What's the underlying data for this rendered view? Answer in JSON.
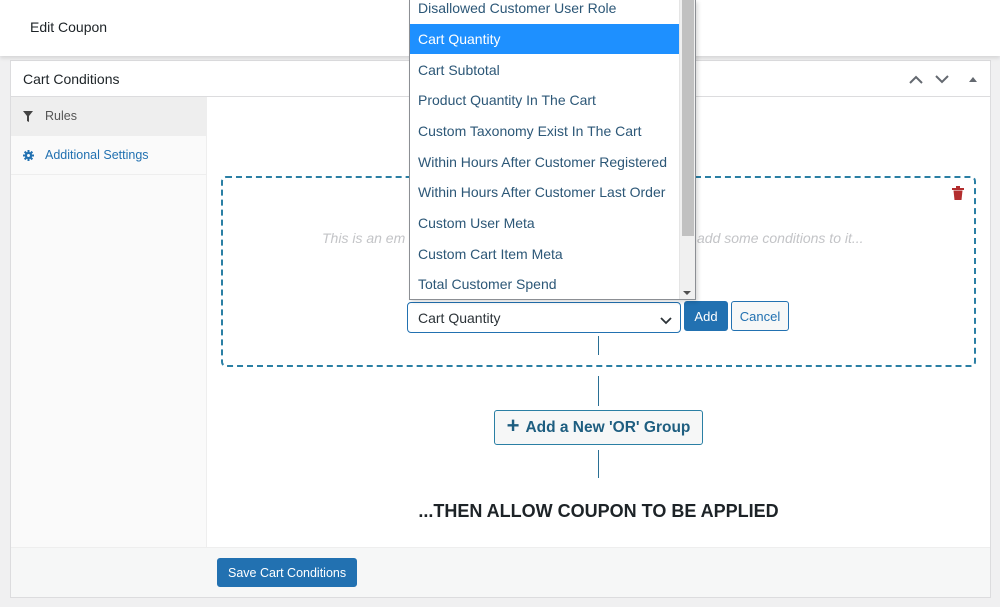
{
  "header": {
    "title": "Edit Coupon"
  },
  "panel": {
    "title": "Cart Conditions",
    "controls": [
      {
        "name": "move-up-icon",
        "glyph": "chevron-up"
      },
      {
        "name": "move-down-icon",
        "glyph": "chevron-down"
      },
      {
        "name": "toggle-panel-icon",
        "glyph": "triangle-up"
      }
    ]
  },
  "sidebar": {
    "items": [
      {
        "label": "Rules",
        "icon": "filter-icon",
        "active": true
      },
      {
        "label": "Additional Settings",
        "icon": "gear-icon",
        "active": false
      }
    ]
  },
  "rule_group": {
    "empty_message_left": "This is an em",
    "empty_message_right": "add some conditions to it...",
    "delete_icon": "trash-icon"
  },
  "condition_select": {
    "value": "Cart Quantity",
    "options_visible": [
      "Disallowed Customer User Role",
      "Cart Quantity",
      "Cart Subtotal",
      "Product Quantity In The Cart",
      "Custom Taxonomy Exist In The Cart",
      "Within Hours After Customer Registered",
      "Within Hours After Customer Last Order",
      "Custom User Meta",
      "Custom Cart Item Meta",
      "Total Customer Spend"
    ],
    "highlighted_index": 1
  },
  "buttons": {
    "add": "Add",
    "cancel": "Cancel",
    "add_or_group": "Add a New 'OR' Group",
    "add_or_group_icon": "+",
    "save": "Save Cart Conditions"
  },
  "then_text": "...THEN ALLOW COUPON TO BE APPLIED",
  "colors": {
    "primary": "#2271b1",
    "highlight": "#1e90ff",
    "delete": "#b32d2e",
    "dashed_border": "#2a7fa4"
  }
}
